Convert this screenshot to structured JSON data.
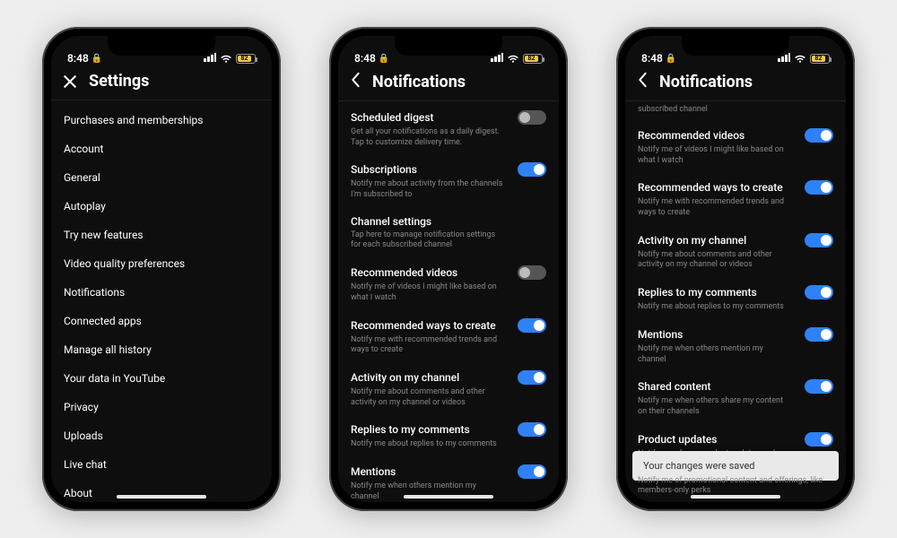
{
  "status": {
    "time": "8:48",
    "battery_pct": "82"
  },
  "phone1": {
    "header_title": "Settings",
    "items": [
      "Purchases and memberships",
      "Account",
      "General",
      "Autoplay",
      "Try new features",
      "Video quality preferences",
      "Notifications",
      "Connected apps",
      "Manage all history",
      "Your data in YouTube",
      "Privacy",
      "Uploads",
      "Live chat",
      "About"
    ]
  },
  "phone2": {
    "header_title": "Notifications",
    "items": [
      {
        "title": "Scheduled digest",
        "desc": "Get all your notifications as a daily digest. Tap to customize delivery time.",
        "toggle": "off"
      },
      {
        "title": "Subscriptions",
        "desc": "Notify me about activity from the channels I'm subscribed to",
        "toggle": "on"
      },
      {
        "title": "Channel settings",
        "desc": "Tap here to manage notification settings for each subscribed channel",
        "toggle": ""
      },
      {
        "title": "Recommended videos",
        "desc": "Notify me of videos I might like based on what I watch",
        "toggle": "off"
      },
      {
        "title": "Recommended ways to create",
        "desc": "Notify me with recommended trends and ways to create",
        "toggle": "on"
      },
      {
        "title": "Activity on my channel",
        "desc": "Notify me about comments and other activity on my channel or videos",
        "toggle": "on"
      },
      {
        "title": "Replies to my comments",
        "desc": "Notify me about replies to my comments",
        "toggle": "on"
      },
      {
        "title": "Mentions",
        "desc": "Notify me when others mention my channel",
        "toggle": "on"
      }
    ]
  },
  "phone3": {
    "header_title": "Notifications",
    "partial_top": "subscribed channel",
    "items": [
      {
        "title": "Recommended videos",
        "desc": "Notify me of videos I might like based on what I watch",
        "toggle": "on"
      },
      {
        "title": "Recommended ways to create",
        "desc": "Notify me with recommended trends and ways to create",
        "toggle": "on"
      },
      {
        "title": "Activity on my channel",
        "desc": "Notify me about comments and other activity on my channel or videos",
        "toggle": "on"
      },
      {
        "title": "Replies to my comments",
        "desc": "Notify me about replies to my comments",
        "toggle": "on"
      },
      {
        "title": "Mentions",
        "desc": "Notify me when others mention my channel",
        "toggle": "on"
      },
      {
        "title": "Shared content",
        "desc": "Notify me when others share my content on their channels",
        "toggle": "on"
      },
      {
        "title": "Product updates",
        "desc": "Notify me of new product updates and announcements",
        "toggle": "on"
      }
    ],
    "toast": "Your changes were saved",
    "under_toast": "Notify me of promotional content and offerings, like members-only perks"
  }
}
